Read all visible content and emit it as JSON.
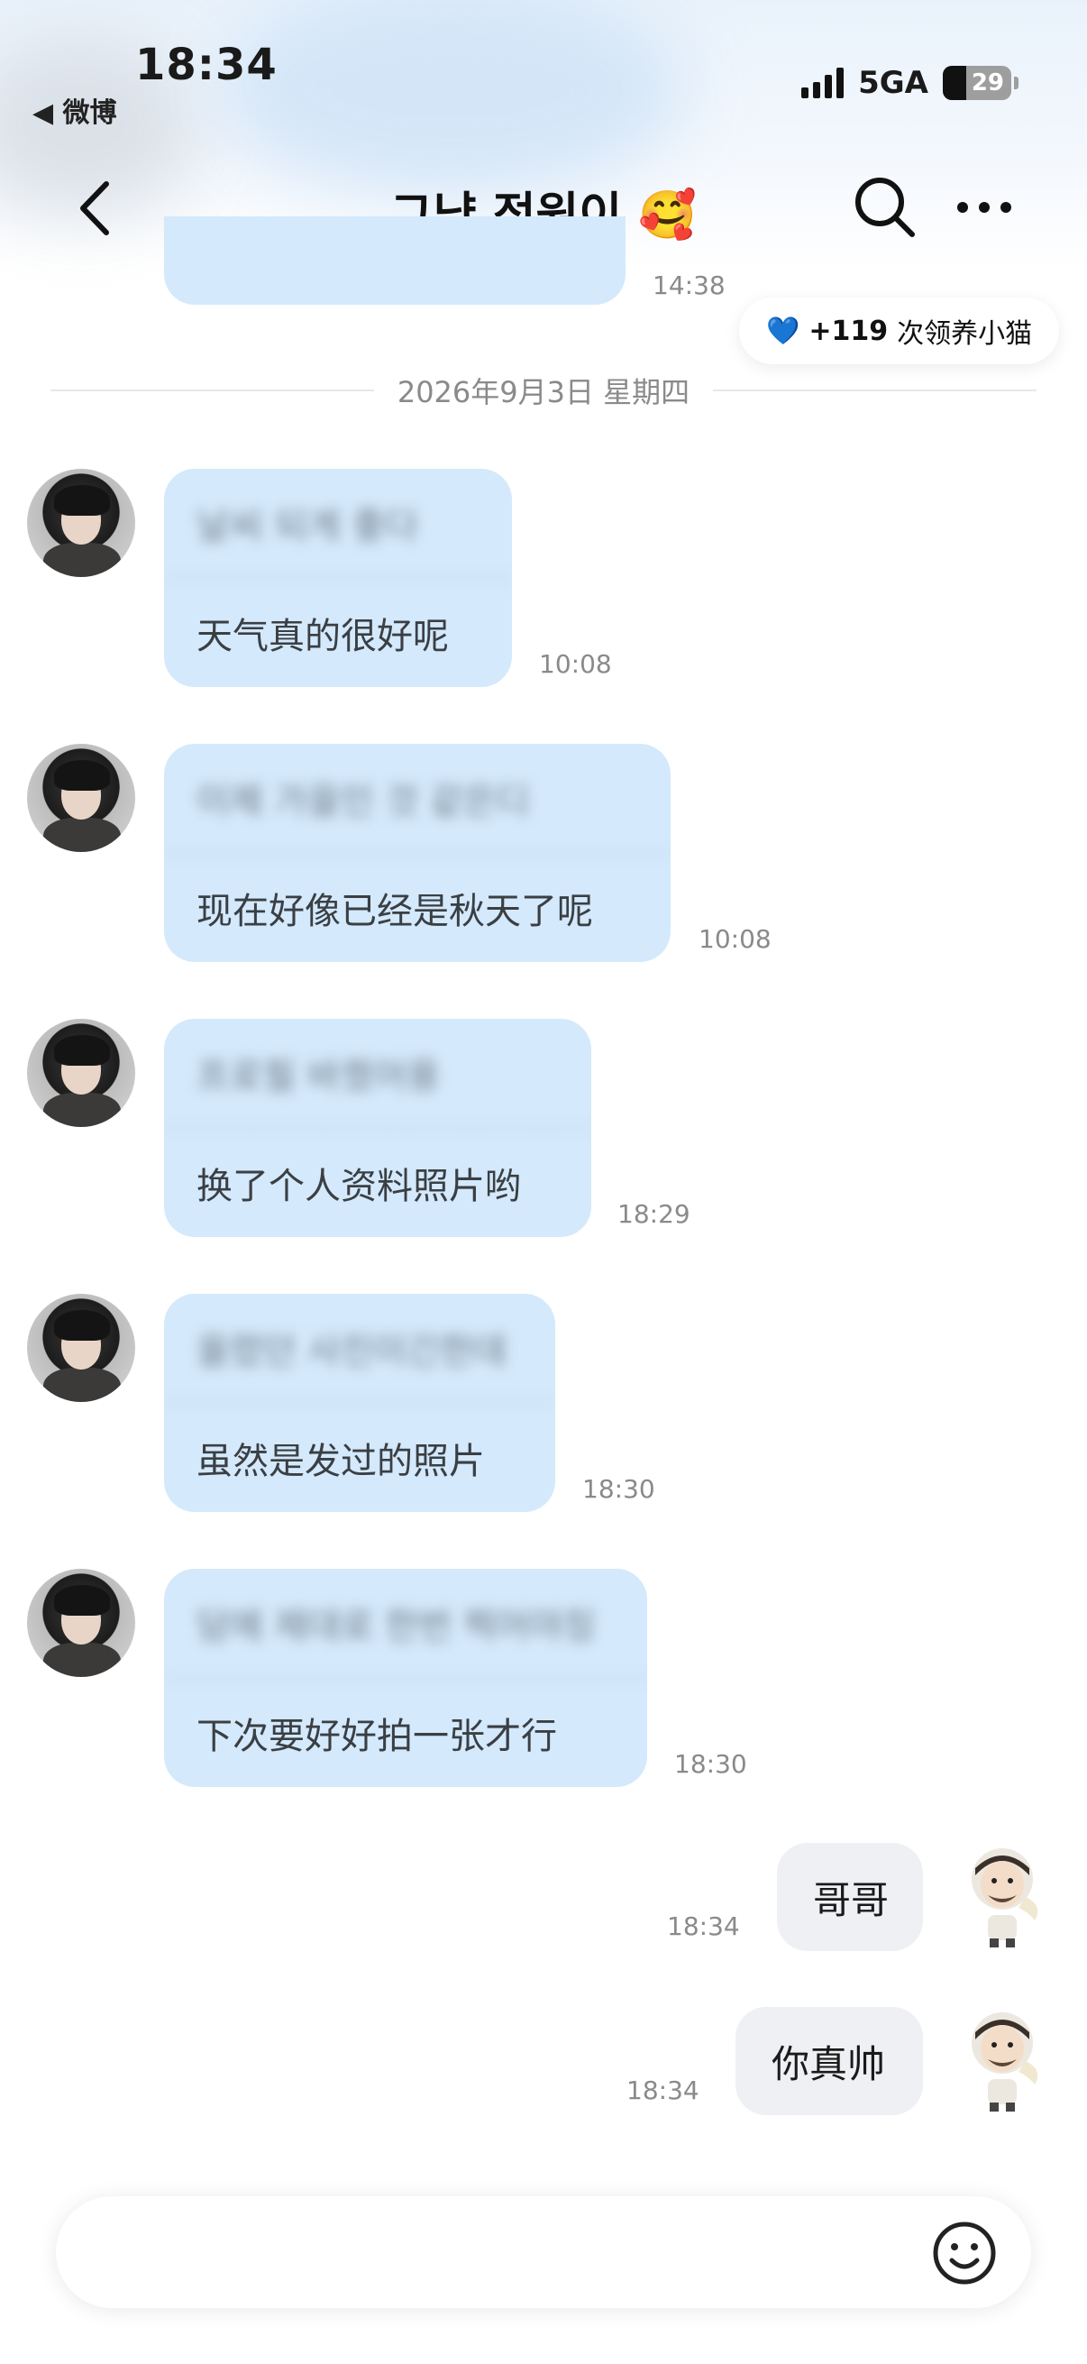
{
  "status_bar": {
    "time": "18:34",
    "back_app": "◀ 微博",
    "network": "5GA",
    "battery": "29"
  },
  "header": {
    "title": "그냥 정원이 🥰"
  },
  "previous_message": {
    "time": "14:38"
  },
  "reward_pill": {
    "heart": "💙",
    "count": "+119",
    "text": "次领养小猫"
  },
  "date_separator": "2026年9月3日 星期四",
  "incoming_messages": [
    {
      "quoted": "날씨 되게 좋다",
      "text": "天气真的很好呢",
      "time": "10:08"
    },
    {
      "quoted": "이제 가을인 것 같은디",
      "text": "现在好像已经是秋天了呢",
      "time": "10:08"
    },
    {
      "quoted": "프로필 바꿨어용",
      "text": "换了个人资料照片哟",
      "time": "18:29"
    },
    {
      "quoted": "올렸던 사진이긴한데",
      "text": "虽然是发过的照片",
      "time": "18:30"
    },
    {
      "quoted": "담에 제대로 한번 찍어야징",
      "text": "下次要好好拍一张才行",
      "time": "18:30"
    }
  ],
  "outgoing_messages": [
    {
      "text": "哥哥",
      "time": "18:34"
    },
    {
      "text": "你真帅",
      "time": "18:34"
    }
  ],
  "colors": {
    "incoming_bubble": "#d4e9fb",
    "outgoing_bubble": "#eef0f4",
    "timestamp": "#8a8a8a"
  }
}
